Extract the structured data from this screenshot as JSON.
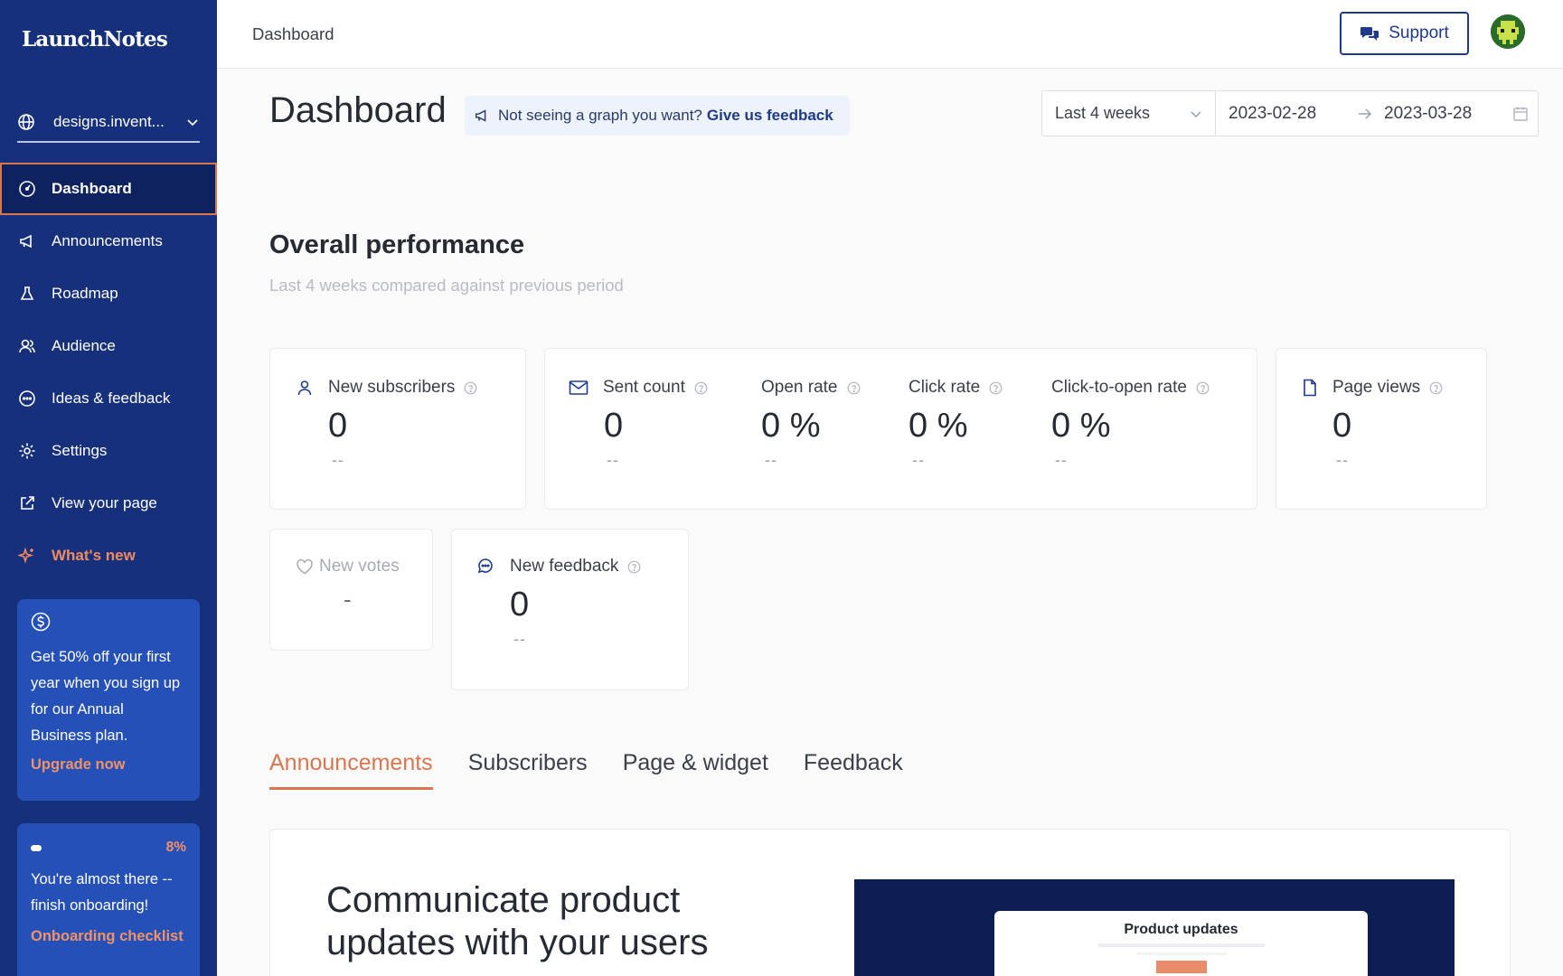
{
  "sidebar": {
    "logo": "LaunchNotes",
    "workspace": "designs.invent...",
    "nav": [
      {
        "label": "Dashboard",
        "icon": "gauge-icon"
      },
      {
        "label": "Announcements",
        "icon": "megaphone-icon"
      },
      {
        "label": "Roadmap",
        "icon": "flask-icon"
      },
      {
        "label": "Audience",
        "icon": "users-icon"
      },
      {
        "label": "Ideas & feedback",
        "icon": "chat-bubble-icon"
      },
      {
        "label": "Settings",
        "icon": "gear-icon"
      },
      {
        "label": "View your page",
        "icon": "external-link-icon"
      },
      {
        "label": "What's new",
        "icon": "sparkle-icon"
      }
    ],
    "promo": {
      "text": "Get 50% off your first year when you sign up for our Annual Business plan.",
      "link": "Upgrade now"
    },
    "onboarding": {
      "progress": 0.08,
      "percent": "8%",
      "text": "You're almost there -- finish onboarding!",
      "link": "Onboarding checklist"
    }
  },
  "header": {
    "breadcrumb": "Dashboard",
    "support_label": "Support"
  },
  "page": {
    "title": "Dashboard",
    "feedback_prompt": "Not seeing a graph you want?",
    "feedback_link": "Give us feedback",
    "date_range": {
      "preset": "Last 4 weeks",
      "from": "2023-02-28",
      "to": "2023-03-28"
    }
  },
  "performance": {
    "title": "Overall performance",
    "subtitle": "Last 4 weeks compared against previous period",
    "metrics": {
      "new_subscribers": {
        "label": "New subscribers",
        "value": "0",
        "delta": "--"
      },
      "sent_count": {
        "label": "Sent count",
        "value": "0",
        "delta": "--"
      },
      "open_rate": {
        "label": "Open rate",
        "value": "0 %",
        "delta": "--"
      },
      "click_rate": {
        "label": "Click rate",
        "value": "0 %",
        "delta": "--"
      },
      "click_to_open_rate": {
        "label": "Click-to-open rate",
        "value": "0 %",
        "delta": "--"
      },
      "page_views": {
        "label": "Page views",
        "value": "0",
        "delta": "--"
      },
      "new_votes": {
        "label": "New votes",
        "value": "-"
      },
      "new_feedback": {
        "label": "New feedback",
        "value": "0",
        "delta": "--"
      }
    }
  },
  "tabs": [
    "Announcements",
    "Subscribers",
    "Page & widget",
    "Feedback"
  ],
  "hero": {
    "title": "Communicate product updates with your users",
    "preview_title": "Product updates"
  },
  "colors": {
    "sidebar_bg": "#16307c",
    "accent": "#d7764f",
    "primary": "#1e3a8a"
  }
}
